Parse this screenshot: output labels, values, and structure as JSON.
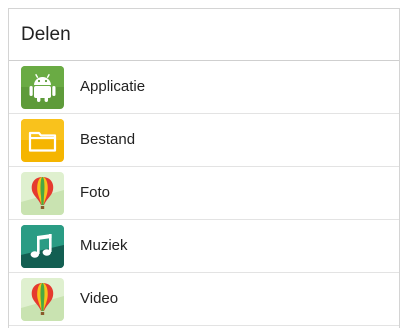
{
  "dialog": {
    "title": "Delen"
  },
  "items": [
    {
      "label": "Applicatie",
      "icon": "android-app-icon",
      "color": "#5e9b3a"
    },
    {
      "label": "Bestand",
      "icon": "folder-icon",
      "color": "#f5b500"
    },
    {
      "label": "Foto",
      "icon": "gallery-balloon-icon",
      "color": "#d8ecc4"
    },
    {
      "label": "Muziek",
      "icon": "music-note-icon",
      "color": "#1d7a6a"
    },
    {
      "label": "Video",
      "icon": "video-balloon-icon",
      "color": "#d8ecc4"
    }
  ]
}
